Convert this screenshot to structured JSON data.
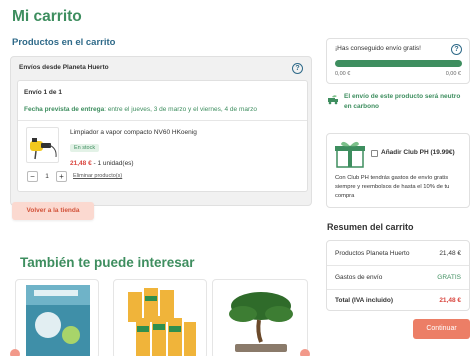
{
  "page": {
    "title": "Mi carrito"
  },
  "cart": {
    "subtitle": "Productos en el carrito",
    "shipping_from": "Envíos desde Planeta Huerto",
    "shipment": {
      "label": "Envío 1 de 1",
      "date_label": "Fecha prevista de entrega",
      "date_value": ": entre el jueves, 3 de marzo y el viernes, 4 de marzo"
    },
    "item": {
      "name": "Limpiador a vapor compacto NV60 HKoenig",
      "stock": "En stock",
      "price": "21,48 €",
      "units": " - 1 unidad(es)",
      "qty": "1",
      "minus": "−",
      "plus": "+",
      "remove": "Eliminar producto(s)"
    },
    "back_button": "Volver a la tienda"
  },
  "recommend": {
    "title": "También te puede interesar"
  },
  "sidebar": {
    "free_shipping": {
      "title": "¡Has conseguido envío gratis!",
      "left": "0,00 €",
      "right": "0,00 €",
      "progress_pct": 100
    },
    "carbon": "El envío de este producto será neutro en carbono",
    "club": {
      "title": "Añadir Club PH (19.99€)",
      "text": "Con Club PH tendrás gastos de envío gratis siempre y reembolsos de hasta el 10% de tu compra"
    },
    "summary": {
      "title": "Resumen del carrito",
      "rows": [
        {
          "label": "Productos Planeta Huerto",
          "value": "21,48 €"
        },
        {
          "label": "Gastos de envío",
          "value": "GRATIS"
        },
        {
          "label": "Total (IVA incluido)",
          "value": "21,48 €"
        }
      ]
    },
    "continue_button": "Continuar"
  },
  "icons": {
    "help": "?",
    "close": "×"
  },
  "colors": {
    "accent_green": "#3e8e5f",
    "heading_blue": "#2f6a89",
    "price_red": "#d9463f",
    "button_orange": "#ec7e66"
  }
}
